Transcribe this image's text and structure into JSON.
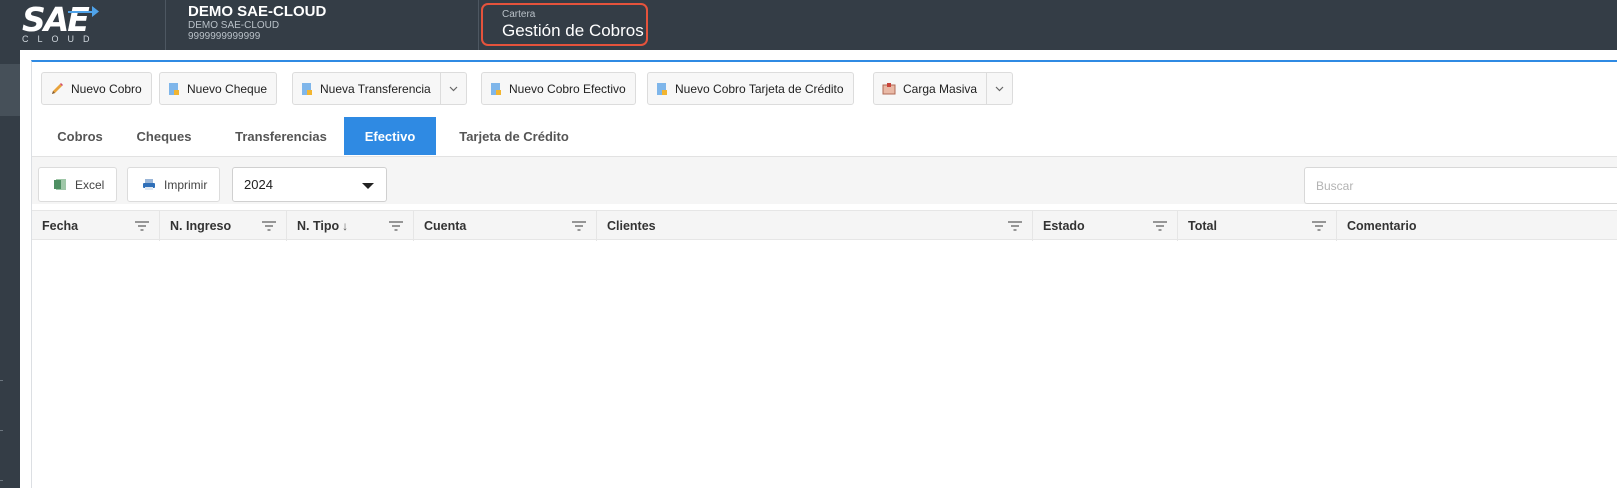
{
  "header": {
    "logo_text": "SAE",
    "logo_sub": "CLOUD",
    "company_name": "DEMO SAE-CLOUD",
    "company_alias": "DEMO SAE-CLOUD",
    "company_id": "9999999999999",
    "module_category": "Cartera",
    "module_title": "Gestión de Cobros"
  },
  "actions": {
    "nuevo_cobro": "Nuevo Cobro",
    "nuevo_cheque": "Nuevo Cheque",
    "nueva_transferencia": "Nueva Transferencia",
    "nuevo_cobro_efectivo": "Nuevo Cobro Efectivo",
    "nuevo_cobro_tarjeta": "Nuevo Cobro Tarjeta de Crédito",
    "carga_masiva": "Carga Masiva"
  },
  "tabs": [
    {
      "label": "Cobros",
      "active": false
    },
    {
      "label": "Cheques",
      "active": false
    },
    {
      "label": "Transferencias",
      "active": false
    },
    {
      "label": "Efectivo",
      "active": true
    },
    {
      "label": "Tarjeta de Crédito",
      "active": false
    }
  ],
  "toolbar": {
    "excel_label": "Excel",
    "print_label": "Imprimir",
    "year_selected": "2024",
    "search_placeholder": "Buscar"
  },
  "grid": {
    "columns": [
      {
        "label": "Fecha"
      },
      {
        "label": "N. Ingreso"
      },
      {
        "label": "N. Tipo",
        "sort": "↓"
      },
      {
        "label": "Cuenta"
      },
      {
        "label": "Clientes"
      },
      {
        "label": "Estado"
      },
      {
        "label": "Total"
      },
      {
        "label": "Comentario"
      }
    ],
    "rows": []
  },
  "colors": {
    "topbar": "#343d46",
    "accent": "#2f8ae3",
    "highlight_border": "#e5533c"
  }
}
